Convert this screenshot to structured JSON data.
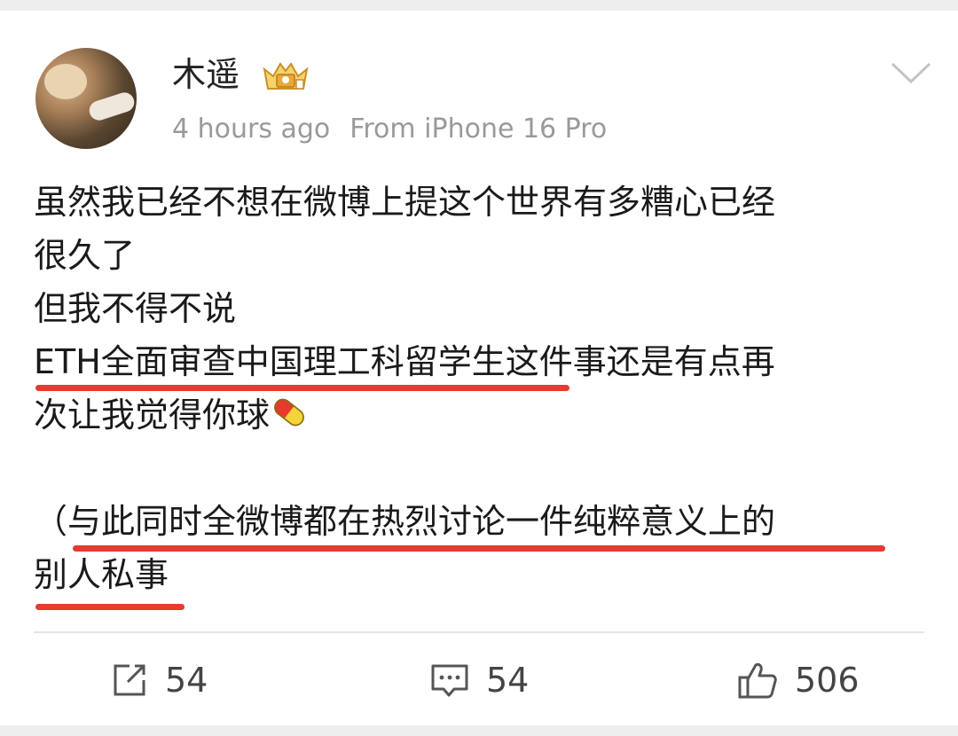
{
  "post": {
    "username": "木遥",
    "time": "4 hours ago",
    "source": "From iPhone 16 Pro",
    "lines": [
      "虽然我已经不想在微博上提这个世界有多糟心已经",
      "很久了",
      "但我不得不说",
      "ETH全面审查中国理工科留学生这件事还是有点再",
      "次让我觉得你球",
      "",
      "（与此同时全微博都在热烈讨论一件纯粹意义上的",
      "别人私事"
    ]
  },
  "actions": {
    "repost_count": "54",
    "comment_count": "54",
    "like_count": "506"
  },
  "icons": {
    "avatar": "avatar-image",
    "badge": "vip-crown-badge-icon",
    "more": "chevron-down-icon",
    "repost": "share-icon",
    "comment": "comment-icon",
    "like": "thumbs-up-icon",
    "pill": "pill-emoji-icon"
  },
  "colors": {
    "underline": "#e63b2e",
    "meta_text": "#9a9a9a",
    "body_text": "#1a1a1a"
  }
}
